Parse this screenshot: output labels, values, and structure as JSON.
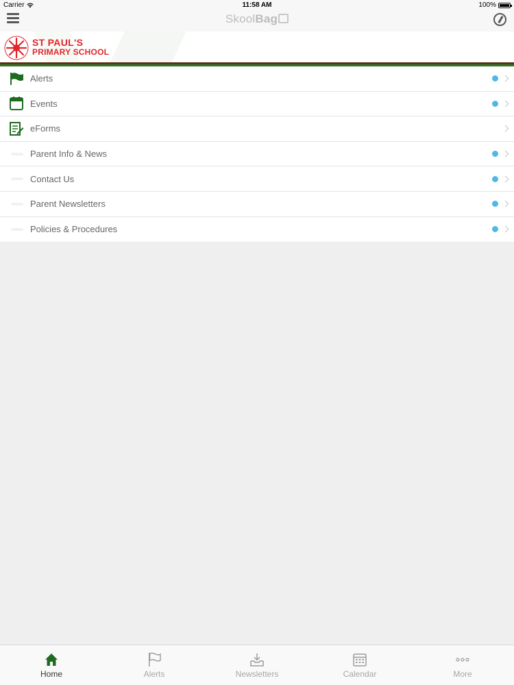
{
  "status_bar": {
    "carrier": "Carrier",
    "time": "11:58 AM",
    "battery": "100%"
  },
  "nav": {
    "brand_light": "Skool",
    "brand_bold": "Bag"
  },
  "school": {
    "name_line1": "ST PAUL'S",
    "name_line2": "PRIMARY SCHOOL"
  },
  "menu": {
    "items": [
      {
        "label": "Alerts",
        "icon": "flag-icon",
        "unread": true
      },
      {
        "label": "Events",
        "icon": "calendar-icon",
        "unread": true
      },
      {
        "label": "eForms",
        "icon": "form-icon",
        "unread": false
      },
      {
        "label": "Parent Info & News",
        "icon": "blank-icon",
        "unread": true
      },
      {
        "label": "Contact Us",
        "icon": "blank-icon",
        "unread": true
      },
      {
        "label": "Parent Newsletters",
        "icon": "blank-icon",
        "unread": true
      },
      {
        "label": "Policies & Procedures",
        "icon": "blank-icon",
        "unread": true
      }
    ]
  },
  "tabs": [
    {
      "label": "Home",
      "icon": "home-icon",
      "active": true
    },
    {
      "label": "Alerts",
      "icon": "flag-icon",
      "active": false
    },
    {
      "label": "Newsletters",
      "icon": "inbox-icon",
      "active": false
    },
    {
      "label": "Calendar",
      "icon": "calendar-icon",
      "active": false
    },
    {
      "label": "More",
      "icon": "more-icon",
      "active": false
    }
  ],
  "colors": {
    "brand_green": "#1f6b1f",
    "school_red": "#e0262b",
    "unread_dot": "#4fb8e8",
    "divider_brown": "#5d2e0f"
  }
}
